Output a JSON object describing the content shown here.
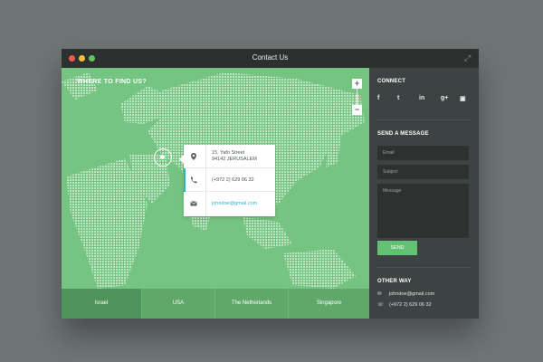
{
  "window": {
    "title": "Contact Us"
  },
  "map": {
    "heading": "WHERE TO FIND US?",
    "zoom_in": "+",
    "zoom_out": "−",
    "colors": {
      "land": "#bfe3c5",
      "water": "#76c482"
    }
  },
  "card": {
    "address_line1": "15, Yafo Street",
    "address_line2": "94142 JERUSALEM",
    "phone": "(+972 2) 629 06 32",
    "email": "johndoe@gmail.com"
  },
  "tabs": [
    {
      "label": "Israel",
      "active": true
    },
    {
      "label": "USA",
      "active": false
    },
    {
      "label": "The Netherlands",
      "active": false
    },
    {
      "label": "Singapore",
      "active": false
    }
  ],
  "sidebar": {
    "connect_title": "CONNECT",
    "social": [
      {
        "icon": "facebook-icon",
        "glyph": "f"
      },
      {
        "icon": "twitter-icon",
        "glyph": "t"
      },
      {
        "icon": "linkedin-icon",
        "glyph": "in"
      },
      {
        "icon": "googleplus-icon",
        "glyph": "g+"
      },
      {
        "icon": "instagram-icon",
        "glyph": "▣"
      }
    ],
    "message_title": "SEND A MESSAGE",
    "email_placeholder": "Email",
    "subject_placeholder": "Subject",
    "message_placeholder": "Message",
    "send_label": "SEND",
    "other_title": "OTHER WAY",
    "email": "johndoe@gmail.com",
    "phone": "(+972 2) 629 06 32"
  },
  "accent": "#2ab3cf",
  "brand_green": "#63c173"
}
